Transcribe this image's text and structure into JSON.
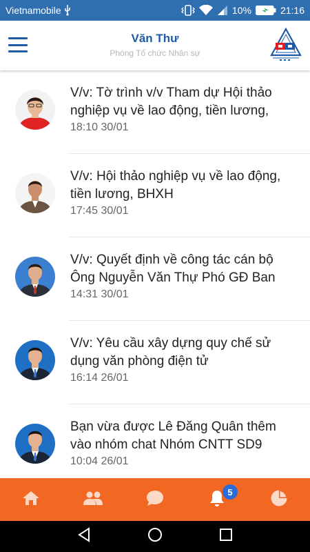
{
  "status_bar": {
    "carrier": "Vietnamobile",
    "battery": "10%",
    "time": "21:16"
  },
  "header": {
    "title": "Văn Thư",
    "subtitle": "Phòng Tổ chức Nhân sự"
  },
  "messages": [
    {
      "title": "V/v: Tờ trình v/v Tham dự Hội thảo nghiệp vụ về lao động, tiền lương, BHXH",
      "time": "18:10 30/01"
    },
    {
      "title": "V/v: Hội thảo nghiệp vụ về lao động, tiền lương, BHXH",
      "time": "17:45 30/01"
    },
    {
      "title": "V/v: Quyết định về công tác cán bộ Ông Nguyễn Văn Thự Phó GĐ Ban",
      "time": "14:31 30/01"
    },
    {
      "title": "V/v: Yêu cầu xây dựng quy chế sử dụng văn phòng điện tử",
      "time": "16:14 26/01"
    },
    {
      "title": "Bạn vừa được Lê Đăng Quân thêm vào nhóm chat Nhóm CNTT SD9",
      "time": "10:04 26/01"
    }
  ],
  "tab_bar": {
    "notification_count": "5",
    "icons": [
      "home-icon",
      "contacts-icon",
      "chat-icon",
      "bell-icon",
      "pie-chart-icon"
    ],
    "bar_color": "#f26722"
  }
}
